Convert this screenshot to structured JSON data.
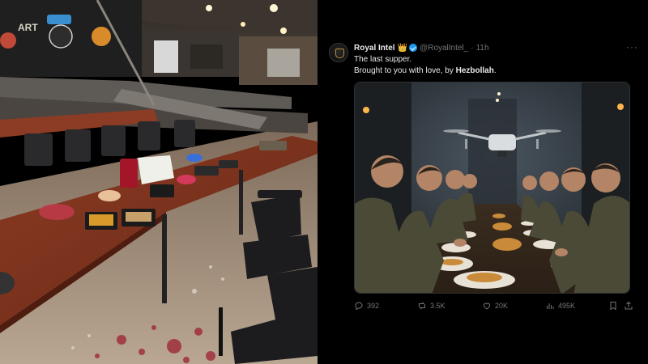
{
  "tweet": {
    "display_name": "Royal Intel",
    "crown": "👑",
    "handle": "@RoyalIntel_",
    "dot": "·",
    "time": "11h",
    "more": "···",
    "line1": "The last supper.",
    "line2_prefix": "Brought to you with love, by ",
    "line2_bold": "Hezbollah",
    "line2_suffix": "."
  },
  "actions": {
    "replies": "392",
    "reposts": "3.5K",
    "likes": "20K",
    "views": "495K"
  },
  "icons": [
    "avatar",
    "verified-badge-icon",
    "more-icon",
    "reply-icon",
    "repost-icon",
    "like-icon",
    "views-icon",
    "bookmark-icon",
    "share-icon"
  ],
  "colors": {
    "background": "#000000",
    "text": "#e7e9ea",
    "muted": "#71767b",
    "verified": "#1d9bf0",
    "crown": "#f4b400"
  }
}
